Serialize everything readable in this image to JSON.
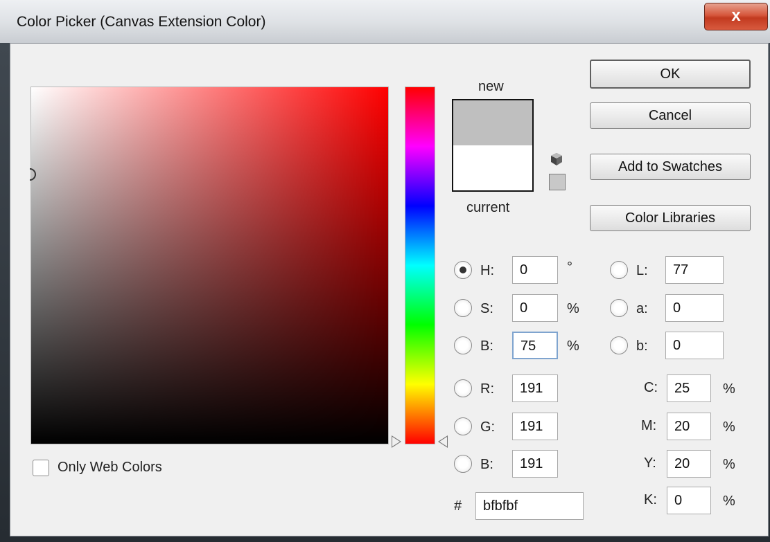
{
  "window": {
    "title": "Color Picker (Canvas Extension Color)",
    "close_label": "x"
  },
  "swatch": {
    "new_label": "new",
    "current_label": "current",
    "new_color": "#bfbfbf",
    "current_color": "#ffffff"
  },
  "buttons": {
    "ok": "OK",
    "cancel": "Cancel",
    "add_to_swatches": "Add to Swatches",
    "color_libraries": "Color Libraries"
  },
  "hsb": {
    "h_label": "H:",
    "h_value": "0",
    "h_unit": "°",
    "s_label": "S:",
    "s_value": "0",
    "s_unit": "%",
    "b_label": "B:",
    "b_value": "75",
    "b_unit": "%",
    "selected": "H"
  },
  "rgb": {
    "r_label": "R:",
    "r_value": "191",
    "g_label": "G:",
    "g_value": "191",
    "b_label": "B:",
    "b_value": "191"
  },
  "lab": {
    "l_label": "L:",
    "l_value": "77",
    "a_label": "a:",
    "a_value": "0",
    "b_label": "b:",
    "b_value": "0"
  },
  "cmyk": {
    "c_label": "C:",
    "c_value": "25",
    "m_label": "M:",
    "m_value": "20",
    "y_label": "Y:",
    "y_value": "20",
    "k_label": "K:",
    "k_value": "0",
    "unit": "%"
  },
  "hex": {
    "label": "#",
    "value": "bfbfbf"
  },
  "only_web_colors": {
    "label": "Only Web Colors",
    "checked": false
  },
  "icons": {
    "cube": "out-of-gamut-cube-icon",
    "websafe": "websafe-swatch-icon"
  },
  "colors": {
    "hue": "#ff0000",
    "accent": "#7fa4cf",
    "close_red": "#c23a1f"
  }
}
